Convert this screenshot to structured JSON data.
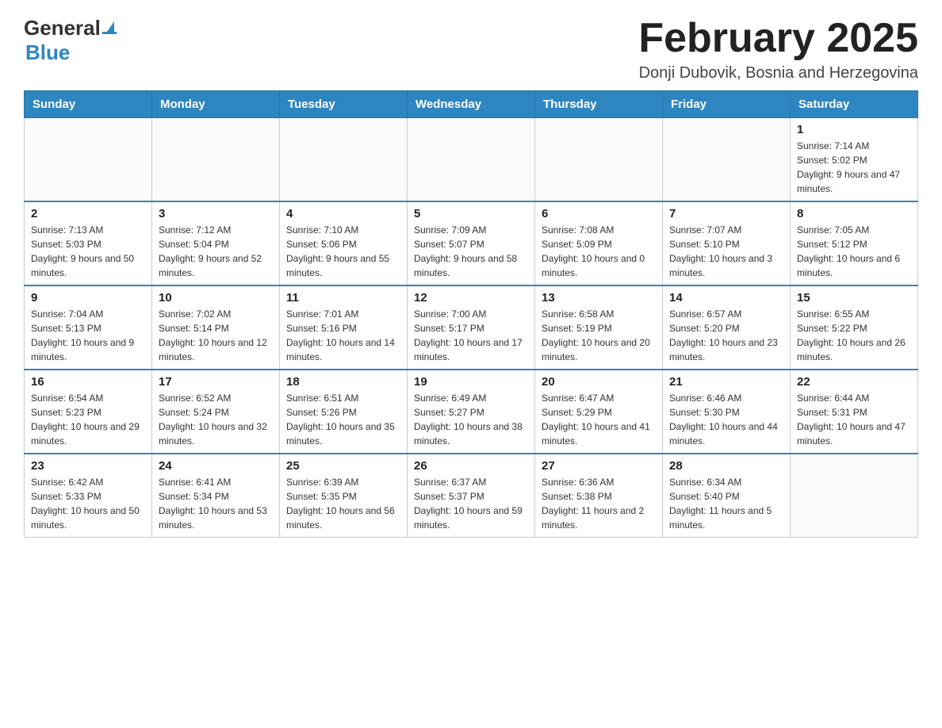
{
  "header": {
    "logo_general": "General",
    "logo_blue": "Blue",
    "title": "February 2025",
    "subtitle": "Donji Dubovik, Bosnia and Herzegovina"
  },
  "calendar": {
    "days_of_week": [
      "Sunday",
      "Monday",
      "Tuesday",
      "Wednesday",
      "Thursday",
      "Friday",
      "Saturday"
    ],
    "weeks": [
      [
        {
          "day": "",
          "info": ""
        },
        {
          "day": "",
          "info": ""
        },
        {
          "day": "",
          "info": ""
        },
        {
          "day": "",
          "info": ""
        },
        {
          "day": "",
          "info": ""
        },
        {
          "day": "",
          "info": ""
        },
        {
          "day": "1",
          "info": "Sunrise: 7:14 AM\nSunset: 5:02 PM\nDaylight: 9 hours and 47 minutes."
        }
      ],
      [
        {
          "day": "2",
          "info": "Sunrise: 7:13 AM\nSunset: 5:03 PM\nDaylight: 9 hours and 50 minutes."
        },
        {
          "day": "3",
          "info": "Sunrise: 7:12 AM\nSunset: 5:04 PM\nDaylight: 9 hours and 52 minutes."
        },
        {
          "day": "4",
          "info": "Sunrise: 7:10 AM\nSunset: 5:06 PM\nDaylight: 9 hours and 55 minutes."
        },
        {
          "day": "5",
          "info": "Sunrise: 7:09 AM\nSunset: 5:07 PM\nDaylight: 9 hours and 58 minutes."
        },
        {
          "day": "6",
          "info": "Sunrise: 7:08 AM\nSunset: 5:09 PM\nDaylight: 10 hours and 0 minutes."
        },
        {
          "day": "7",
          "info": "Sunrise: 7:07 AM\nSunset: 5:10 PM\nDaylight: 10 hours and 3 minutes."
        },
        {
          "day": "8",
          "info": "Sunrise: 7:05 AM\nSunset: 5:12 PM\nDaylight: 10 hours and 6 minutes."
        }
      ],
      [
        {
          "day": "9",
          "info": "Sunrise: 7:04 AM\nSunset: 5:13 PM\nDaylight: 10 hours and 9 minutes."
        },
        {
          "day": "10",
          "info": "Sunrise: 7:02 AM\nSunset: 5:14 PM\nDaylight: 10 hours and 12 minutes."
        },
        {
          "day": "11",
          "info": "Sunrise: 7:01 AM\nSunset: 5:16 PM\nDaylight: 10 hours and 14 minutes."
        },
        {
          "day": "12",
          "info": "Sunrise: 7:00 AM\nSunset: 5:17 PM\nDaylight: 10 hours and 17 minutes."
        },
        {
          "day": "13",
          "info": "Sunrise: 6:58 AM\nSunset: 5:19 PM\nDaylight: 10 hours and 20 minutes."
        },
        {
          "day": "14",
          "info": "Sunrise: 6:57 AM\nSunset: 5:20 PM\nDaylight: 10 hours and 23 minutes."
        },
        {
          "day": "15",
          "info": "Sunrise: 6:55 AM\nSunset: 5:22 PM\nDaylight: 10 hours and 26 minutes."
        }
      ],
      [
        {
          "day": "16",
          "info": "Sunrise: 6:54 AM\nSunset: 5:23 PM\nDaylight: 10 hours and 29 minutes."
        },
        {
          "day": "17",
          "info": "Sunrise: 6:52 AM\nSunset: 5:24 PM\nDaylight: 10 hours and 32 minutes."
        },
        {
          "day": "18",
          "info": "Sunrise: 6:51 AM\nSunset: 5:26 PM\nDaylight: 10 hours and 35 minutes."
        },
        {
          "day": "19",
          "info": "Sunrise: 6:49 AM\nSunset: 5:27 PM\nDaylight: 10 hours and 38 minutes."
        },
        {
          "day": "20",
          "info": "Sunrise: 6:47 AM\nSunset: 5:29 PM\nDaylight: 10 hours and 41 minutes."
        },
        {
          "day": "21",
          "info": "Sunrise: 6:46 AM\nSunset: 5:30 PM\nDaylight: 10 hours and 44 minutes."
        },
        {
          "day": "22",
          "info": "Sunrise: 6:44 AM\nSunset: 5:31 PM\nDaylight: 10 hours and 47 minutes."
        }
      ],
      [
        {
          "day": "23",
          "info": "Sunrise: 6:42 AM\nSunset: 5:33 PM\nDaylight: 10 hours and 50 minutes."
        },
        {
          "day": "24",
          "info": "Sunrise: 6:41 AM\nSunset: 5:34 PM\nDaylight: 10 hours and 53 minutes."
        },
        {
          "day": "25",
          "info": "Sunrise: 6:39 AM\nSunset: 5:35 PM\nDaylight: 10 hours and 56 minutes."
        },
        {
          "day": "26",
          "info": "Sunrise: 6:37 AM\nSunset: 5:37 PM\nDaylight: 10 hours and 59 minutes."
        },
        {
          "day": "27",
          "info": "Sunrise: 6:36 AM\nSunset: 5:38 PM\nDaylight: 11 hours and 2 minutes."
        },
        {
          "day": "28",
          "info": "Sunrise: 6:34 AM\nSunset: 5:40 PM\nDaylight: 11 hours and 5 minutes."
        },
        {
          "day": "",
          "info": ""
        }
      ]
    ]
  }
}
